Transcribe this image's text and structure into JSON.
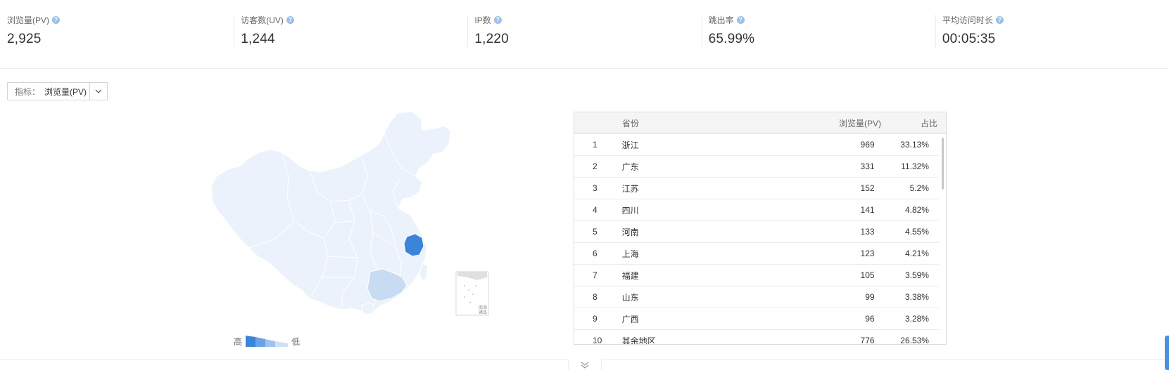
{
  "stats": [
    {
      "label": "浏览量(PV)",
      "value": "2,925"
    },
    {
      "label": "访客数(UV)",
      "value": "1,244"
    },
    {
      "label": "IP数",
      "value": "1,220"
    },
    {
      "label": "跳出率",
      "value": "65.99%"
    },
    {
      "label": "平均访问时长",
      "value": "00:05:35"
    }
  ],
  "help_icon_glyph": "?",
  "metric_select": {
    "label": "指标：",
    "value": "浏览量(PV)"
  },
  "legend": {
    "high": "高",
    "low": "低"
  },
  "map": {
    "inset_label_line1": "南海",
    "inset_label_line2": "诸岛",
    "base_color": "#ebf2fb",
    "highlight_color": "#3b84d9",
    "secondary_color": "#c7dcf3"
  },
  "table": {
    "headers": {
      "rank": "",
      "name": "省份",
      "pv": "浏览量(PV)",
      "ratio": "占比"
    },
    "rows": [
      {
        "rank": "1",
        "name": "浙江",
        "pv": "969",
        "ratio": "33.13%"
      },
      {
        "rank": "2",
        "name": "广东",
        "pv": "331",
        "ratio": "11.32%"
      },
      {
        "rank": "3",
        "name": "江苏",
        "pv": "152",
        "ratio": "5.2%"
      },
      {
        "rank": "4",
        "name": "四川",
        "pv": "141",
        "ratio": "4.82%"
      },
      {
        "rank": "5",
        "name": "河南",
        "pv": "133",
        "ratio": "4.55%"
      },
      {
        "rank": "6",
        "name": "上海",
        "pv": "123",
        "ratio": "4.21%"
      },
      {
        "rank": "7",
        "name": "福建",
        "pv": "105",
        "ratio": "3.59%"
      },
      {
        "rank": "8",
        "name": "山东",
        "pv": "99",
        "ratio": "3.38%"
      },
      {
        "rank": "9",
        "name": "广西",
        "pv": "96",
        "ratio": "3.28%"
      },
      {
        "rank": "10",
        "name": "其余地区",
        "pv": "776",
        "ratio": "26.53%"
      }
    ]
  }
}
